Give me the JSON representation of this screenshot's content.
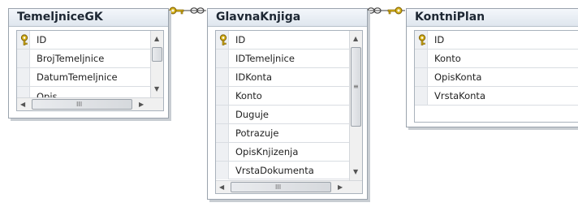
{
  "tables": [
    {
      "title": "TemeljniceGK",
      "columns": [
        "ID",
        "BrojTemeljnice",
        "DatumTemeljnice",
        "Opis"
      ],
      "primary_key": "ID"
    },
    {
      "title": "GlavnaKnjiga",
      "columns": [
        "ID",
        "IDTemeljnice",
        "IDKonta",
        "Konto",
        "Duguje",
        "Potrazuje",
        "OpisKnjizenja",
        "VrstaDokumenta"
      ],
      "primary_key": "ID"
    },
    {
      "title": "KontniPlan",
      "columns": [
        "ID",
        "Konto",
        "OpisKonta",
        "VrstaKonta"
      ],
      "primary_key": "ID"
    }
  ],
  "relationships": [
    {
      "from": "TemeljniceGK",
      "to": "GlavnaKnjiga",
      "one_icon": "key-icon",
      "many_icon": "infinity-icon"
    },
    {
      "from": "KontniPlan",
      "to": "GlavnaKnjiga",
      "one_icon": "key-icon",
      "many_icon": "infinity-icon"
    }
  ],
  "colors": {
    "key": "#d4b01a",
    "key_outline": "#7a5c00",
    "title_gradient_top": "#f4f7fb",
    "title_gradient_bottom": "#dfe6ee",
    "border": "#9aa3ad"
  },
  "scrollbar_glyphs": {
    "up": "▲",
    "down": "▼",
    "left": "◀",
    "right": "▶",
    "grip_h": "III",
    "grip_v": "≡"
  }
}
